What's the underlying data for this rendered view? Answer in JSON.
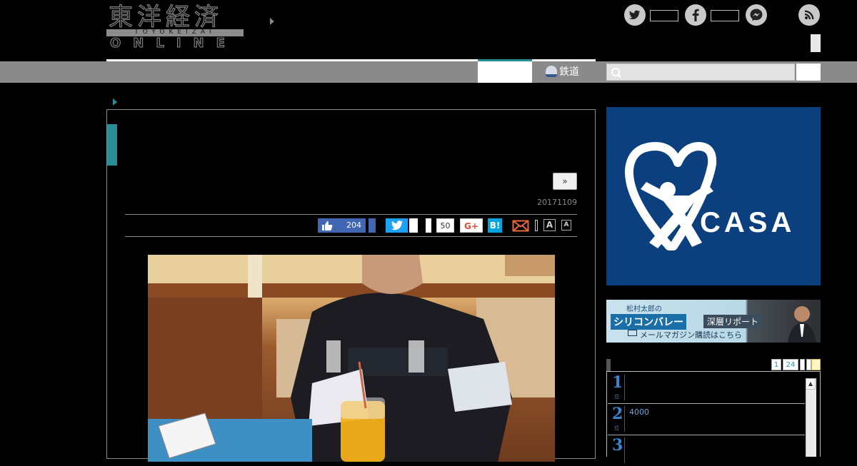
{
  "header": {
    "logo_main": "東洋経済",
    "logo_sub": "TOYOKEIZAI",
    "logo_en": "ONLINE"
  },
  "social": {
    "twitter_icon": "twitter-icon",
    "facebook_icon": "facebook-icon",
    "messenger_icon": "messenger-icon",
    "rss_icon": "rss-icon"
  },
  "nav": {
    "rail_label": "鉄道",
    "search_placeholder": ""
  },
  "article": {
    "next_label": "»",
    "date": "20171109",
    "share": {
      "like_count": "204",
      "hatena_count": "50",
      "gplus_label": "G+",
      "hatena_label": "B!"
    },
    "font_large": "A",
    "font_small": "A"
  },
  "sidebar": {
    "ad_casa_text": "CASA",
    "ad_casa_reg": "®",
    "ad_sv": {
      "top": "松村太郎の",
      "main": "シリコンバレー",
      "tag": "深層リポート",
      "mail": "メールマガジン購読はこちら"
    },
    "ranking": {
      "tabs": [
        "1",
        "24"
      ],
      "rows": [
        {
          "rank": "1",
          "text": ""
        },
        {
          "rank": "2",
          "text": "4000"
        },
        {
          "rank": "3",
          "text": ""
        }
      ]
    }
  },
  "colors": {
    "accent": "#2a8f95",
    "nav_gray": "#8a8a8a",
    "facebook": "#4267b2",
    "twitter": "#1da1f2",
    "hatena": "#00a4de",
    "casa_blue": "#0b3f7d"
  }
}
